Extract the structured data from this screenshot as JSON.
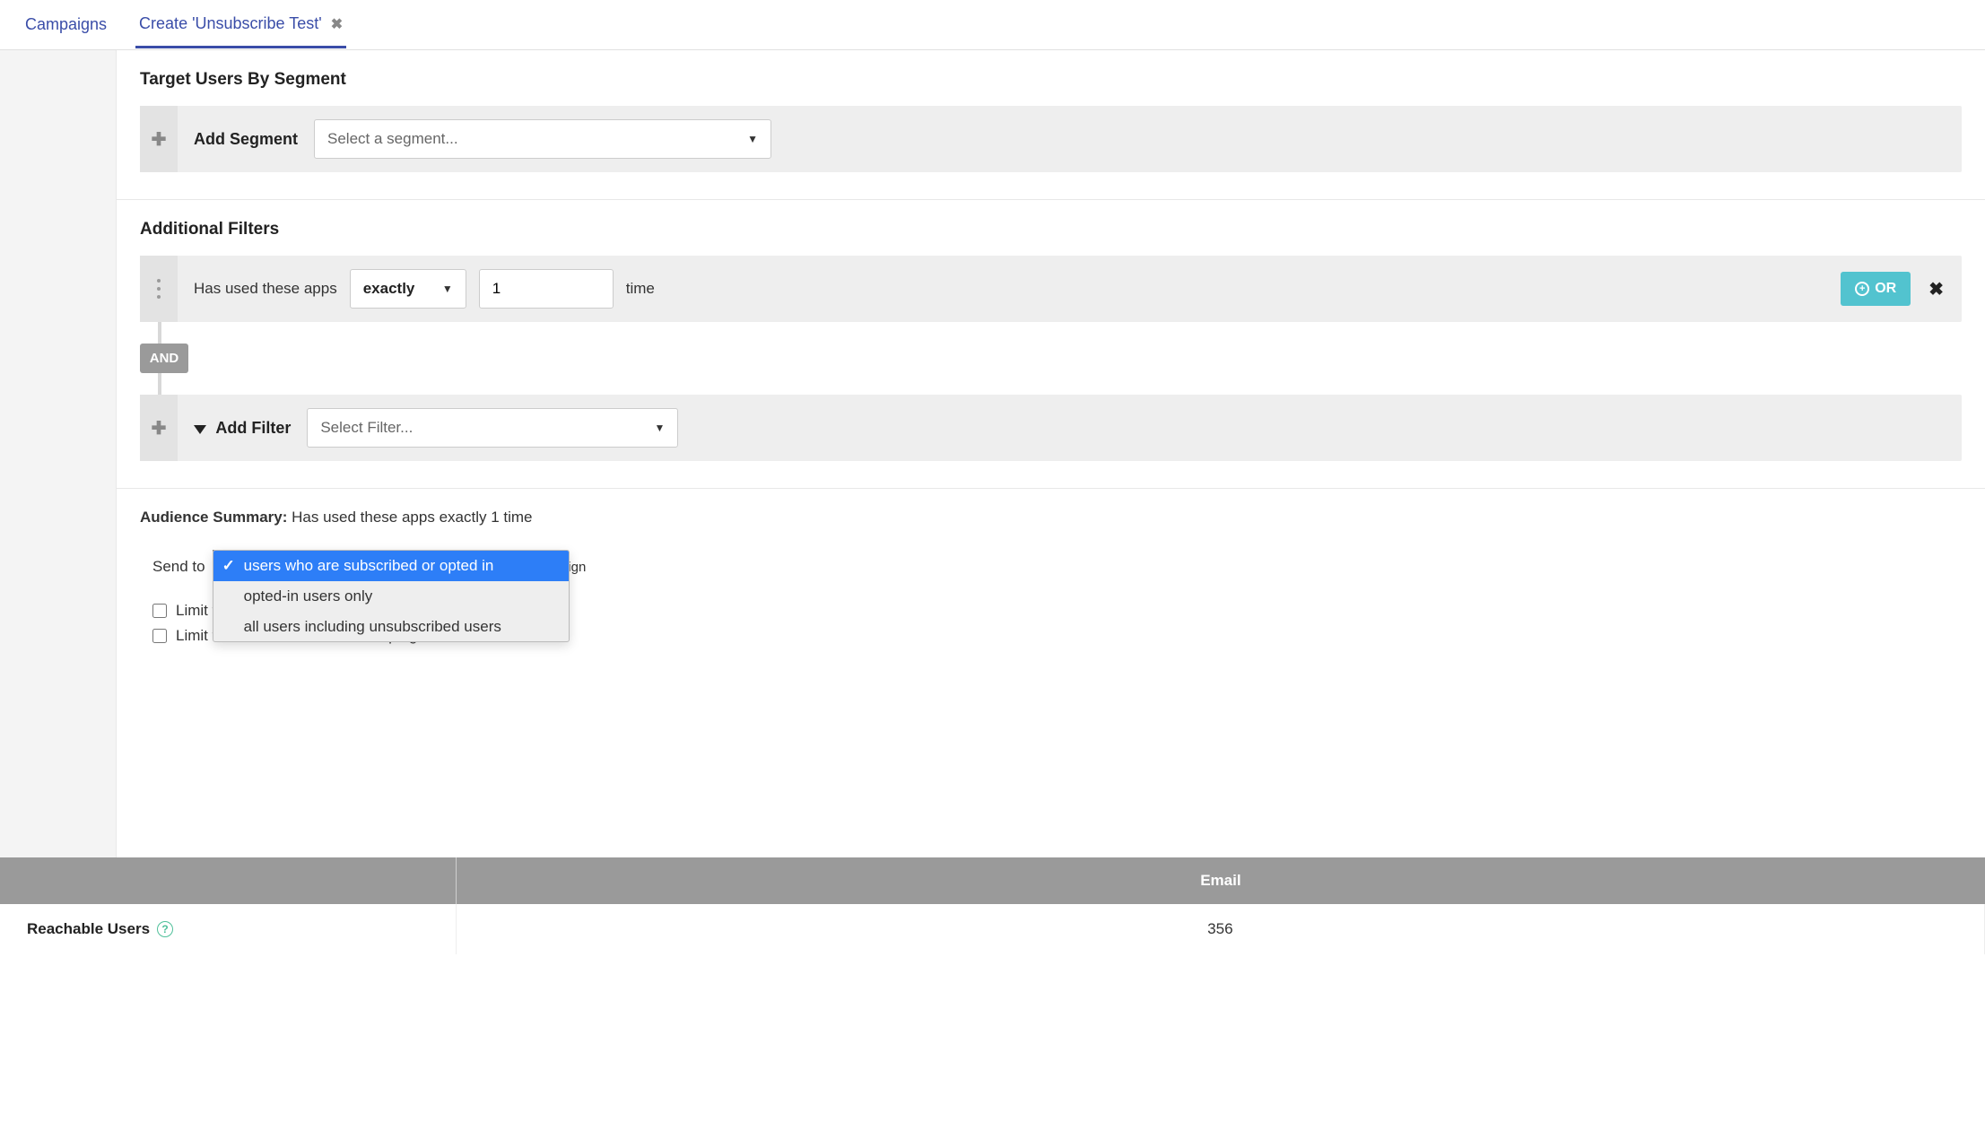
{
  "tabs": {
    "campaigns": "Campaigns",
    "create": "Create 'Unsubscribe Test'"
  },
  "targetSegment": {
    "title": "Target Users By Segment",
    "addLabel": "Add Segment",
    "selectPlaceholder": "Select a segment..."
  },
  "filters": {
    "title": "Additional Filters",
    "rule": {
      "prefix": "Has used these apps",
      "operator": "exactly",
      "count": "1",
      "suffix": "time"
    },
    "orLabel": "OR",
    "andLabel": "AND",
    "addFilterLabel": "Add Filter",
    "selectFilterPlaceholder": "Select Filter..."
  },
  "summary": {
    "label": "Audience Summary:",
    "text": "Has used these apps exactly 1 time",
    "sendToLabel": "Send to",
    "dropdown": {
      "options": [
        "users who are subscribed or opted in",
        "opted-in users only",
        "all users including unsubscribed users"
      ],
      "selectedIndex": 0
    },
    "campaignSuffixVisible": "paign",
    "limitUsers": "Limit the number of users who will receive this Campaign",
    "limitRate": "Limit the rate at which this Campaign will send"
  },
  "reach": {
    "headerBlank": "",
    "headerEmail": "Email",
    "rowLabel": "Reachable Users",
    "rowValue": "356"
  }
}
